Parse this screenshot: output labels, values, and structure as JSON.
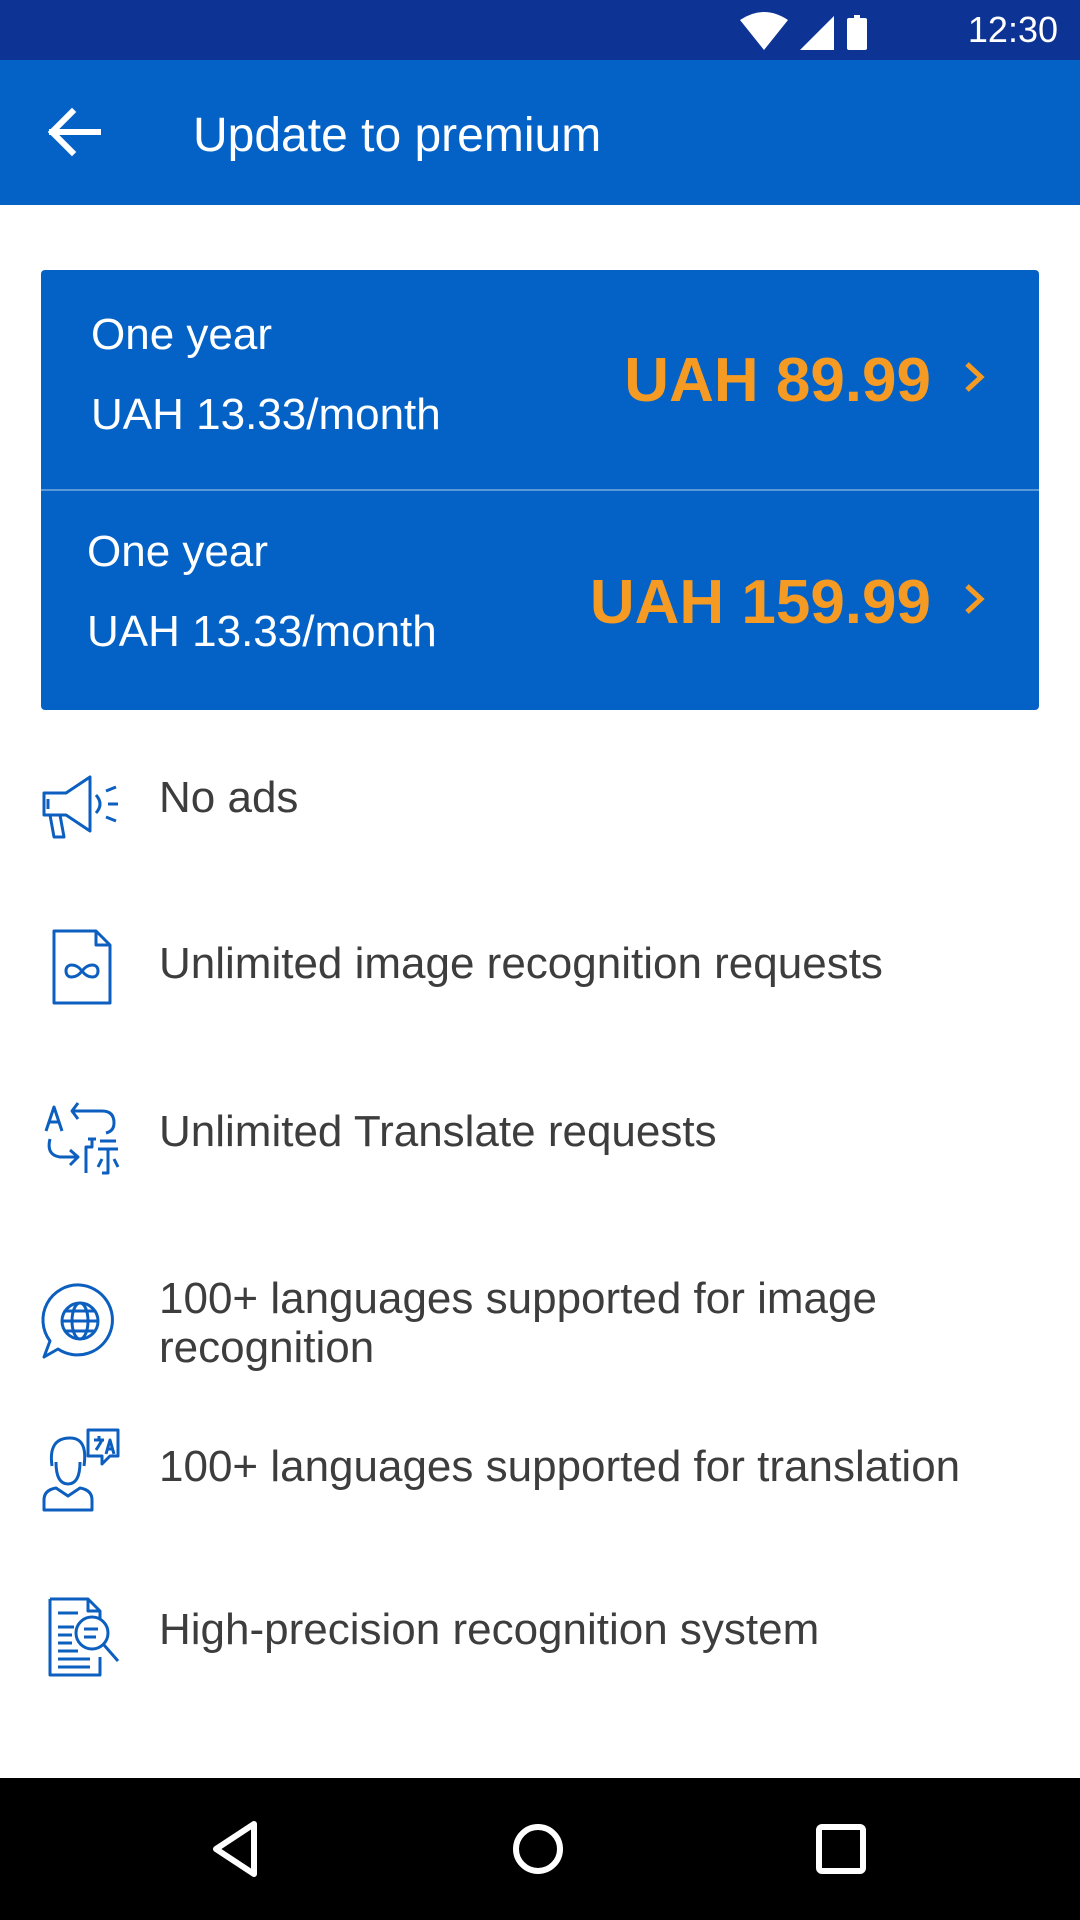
{
  "status_bar": {
    "time": "12:30",
    "icons": [
      "wifi-icon",
      "cellular-signal-icon",
      "battery-icon"
    ]
  },
  "app_bar": {
    "title": "Update to premium",
    "back_icon": "arrow-left-icon"
  },
  "plans": [
    {
      "name": "One year",
      "monthly": "UAH 13.33/month",
      "price": "UAH 89.99"
    },
    {
      "name": "One year",
      "monthly": "UAH 13.33/month",
      "price": "UAH 159.99"
    }
  ],
  "features": [
    {
      "icon": "megaphone-icon",
      "text": "No ads"
    },
    {
      "icon": "infinity-file-icon",
      "text": "Unlimited image recognition requests"
    },
    {
      "icon": "translate-arrows-icon",
      "text": "Unlimited Translate requests"
    },
    {
      "icon": "globe-chat-icon",
      "text": "100+ languages supported for image recognition"
    },
    {
      "icon": "person-translate-icon",
      "text": "100+ languages supported for translation"
    },
    {
      "icon": "document-search-icon",
      "text": "High-precision recognition system"
    }
  ],
  "nav_bar": {
    "buttons": [
      "back-triangle-icon",
      "home-circle-icon",
      "recents-square-icon"
    ]
  },
  "colors": {
    "status_bar": "#0d3494",
    "app_bar": "#0462c6",
    "card": "#0462c6",
    "price": "#f59a23",
    "icon_blue": "#0d5fbf",
    "feature_text": "#3d3d3d"
  }
}
